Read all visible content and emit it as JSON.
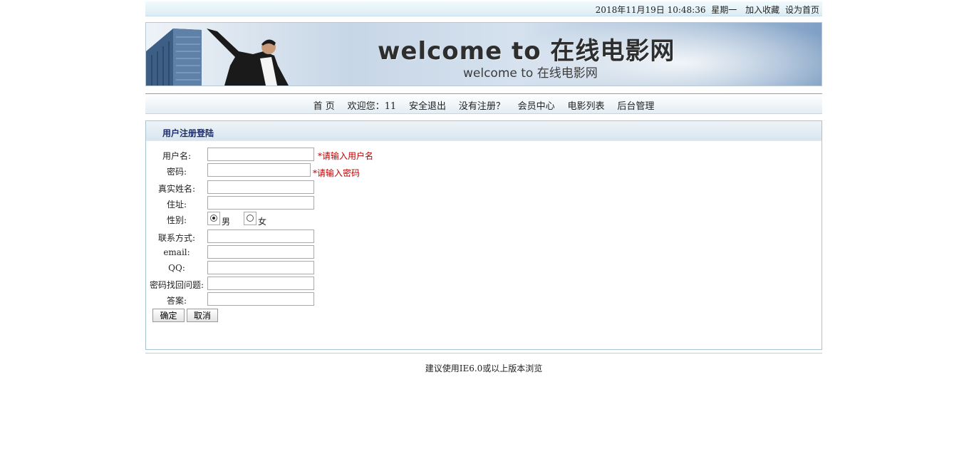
{
  "topbar": {
    "datetime": "2018年11月19日 10:48:36",
    "weekday": "星期一",
    "bookmark": "加入收藏",
    "homepage": "设为首页"
  },
  "banner": {
    "title": "welcome to 在线电影网",
    "subtitle": "welcome to 在线电影网"
  },
  "nav": {
    "items": [
      "首 页",
      "欢迎您：11",
      "安全退出",
      "没有注册？",
      "会员中心",
      "电影列表",
      "后台管理"
    ]
  },
  "form": {
    "title": "用户注册登陆",
    "username_label": "用户名:",
    "username_hint": "*请输入用户名",
    "password_label": "密码:",
    "password_hint": "*请输入密码",
    "realname_label": "真实姓名:",
    "address_label": "住址:",
    "gender_label": "性别:",
    "gender_male": "男",
    "gender_female": "女",
    "gender_selected": "男",
    "contact_label": "联系方式:",
    "email_label": "email:",
    "qq_label": "QQ:",
    "question_label": "密码找回问题:",
    "answer_label": "答案:",
    "submit_label": "确定",
    "cancel_label": "取消"
  },
  "footer": {
    "text": "建议使用IE6.0或以上版本浏览"
  },
  "colors": {
    "required": "#c00000",
    "panel_title": "#1a2b6d",
    "border": "#a7c3d6"
  }
}
